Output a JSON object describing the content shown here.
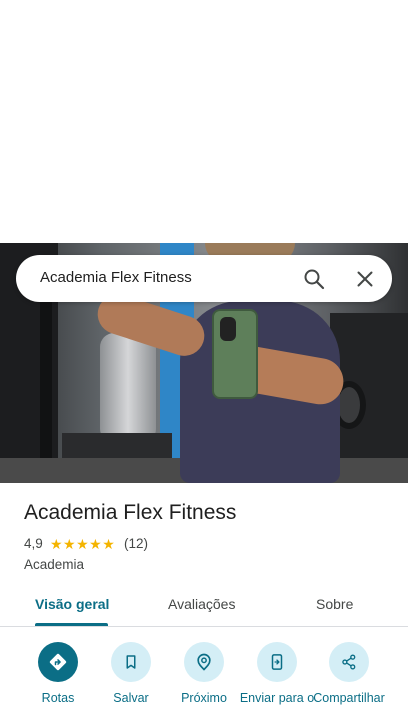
{
  "search": {
    "query": "Academia Flex Fitness"
  },
  "place": {
    "title": "Academia Flex Fitness",
    "rating": "4,9",
    "stars": "★★★★★",
    "review_count": "(12)",
    "category": "Academia"
  },
  "tabs": [
    {
      "label": "Visão geral",
      "active": true
    },
    {
      "label": "Avaliações",
      "active": false
    },
    {
      "label": "Sobre",
      "active": false
    }
  ],
  "actions": [
    {
      "label": "Rotas",
      "icon": "directions-icon"
    },
    {
      "label": "Salvar",
      "icon": "bookmark-icon"
    },
    {
      "label": "Próximo",
      "icon": "nearby-icon"
    },
    {
      "label": "Enviar para o",
      "icon": "send-to-phone-icon"
    },
    {
      "label": "Compartilhar",
      "icon": "share-icon"
    }
  ],
  "colors": {
    "accent": "#0b6e86",
    "action_bg": "#d4eef6",
    "star": "#f4b400"
  }
}
